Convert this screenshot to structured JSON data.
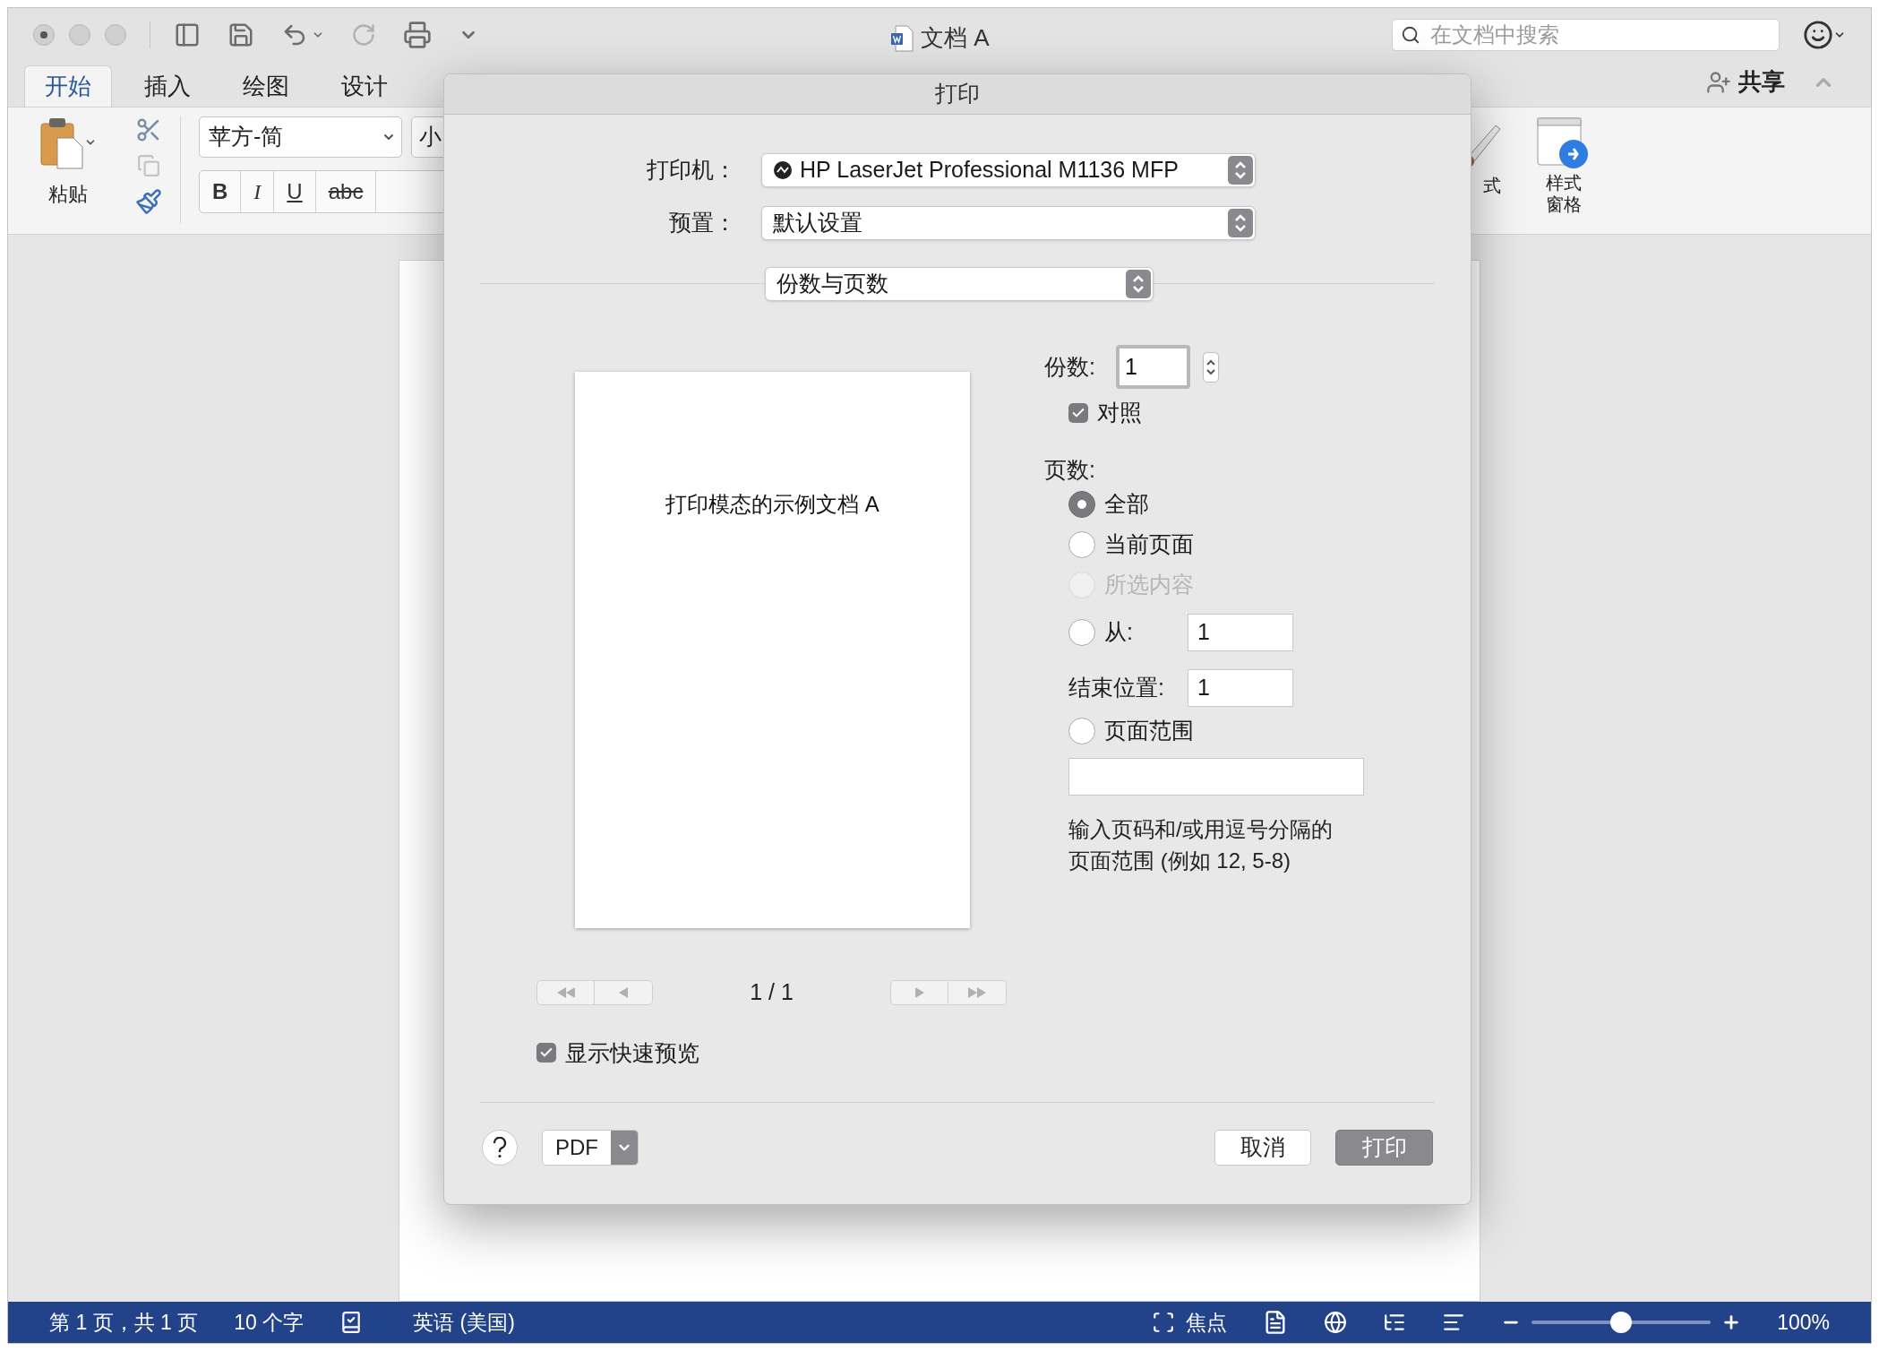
{
  "window": {
    "title": "文档 A",
    "search": {
      "placeholder": "在文档中搜索"
    }
  },
  "tabs": [
    {
      "label": "开始",
      "selected": true
    },
    {
      "label": "插入",
      "selected": false
    },
    {
      "label": "绘图",
      "selected": false
    },
    {
      "label": "设计",
      "selected": false
    }
  ],
  "share": "共享",
  "ribbon": {
    "paste": "粘贴",
    "font": "苹方-简",
    "font_size": "小",
    "format_buttons": [
      {
        "label": "B",
        "kind": "bold"
      },
      {
        "label": "I",
        "kind": "italic"
      },
      {
        "label": "U",
        "kind": "underline"
      },
      {
        "label": "abc",
        "kind": "strike"
      }
    ],
    "styles": "式",
    "styles_pane": "样式窗格"
  },
  "dialog": {
    "title": "打印",
    "printer": {
      "label": "打印机：",
      "value": "HP LaserJet Professional M1136 MFP"
    },
    "preset": {
      "label": "预置：",
      "value": "默认设置"
    },
    "section": "份数与页数",
    "preview_text": "打印模态的示例文档 A",
    "page_counter": "1 / 1",
    "quick_preview": {
      "label": "显示快速预览",
      "checked": true
    },
    "copies": {
      "label": "份数:",
      "value": "1"
    },
    "collate": {
      "label": "对照",
      "checked": true
    },
    "pages_label": "页数:",
    "page_options": [
      {
        "kind": "radio",
        "label": "全部",
        "selected": true,
        "disabled": false
      },
      {
        "kind": "radio",
        "label": "当前页面",
        "selected": false,
        "disabled": false
      },
      {
        "kind": "radio",
        "label": "所选内容",
        "selected": false,
        "disabled": true
      },
      {
        "kind": "radio_field",
        "label": "从:",
        "value": "1",
        "selected": false,
        "disabled": false
      },
      {
        "kind": "field",
        "label": "结束位置:",
        "value": "1"
      },
      {
        "kind": "radio",
        "label": "页面范围",
        "selected": false,
        "disabled": false
      },
      {
        "kind": "blank_field"
      }
    ],
    "hint": "输入页码和/或用逗号分隔的页面范围 (例如 12, 5-8)",
    "pdf": "PDF",
    "cancel": "取消",
    "print": "打印"
  },
  "status_bar": {
    "page": "第 1 页，共 1 页",
    "words": "10 个字",
    "language": "英语 (美国)",
    "focus": "焦点",
    "zoom": {
      "level": 0.5,
      "reading": "100%"
    }
  }
}
